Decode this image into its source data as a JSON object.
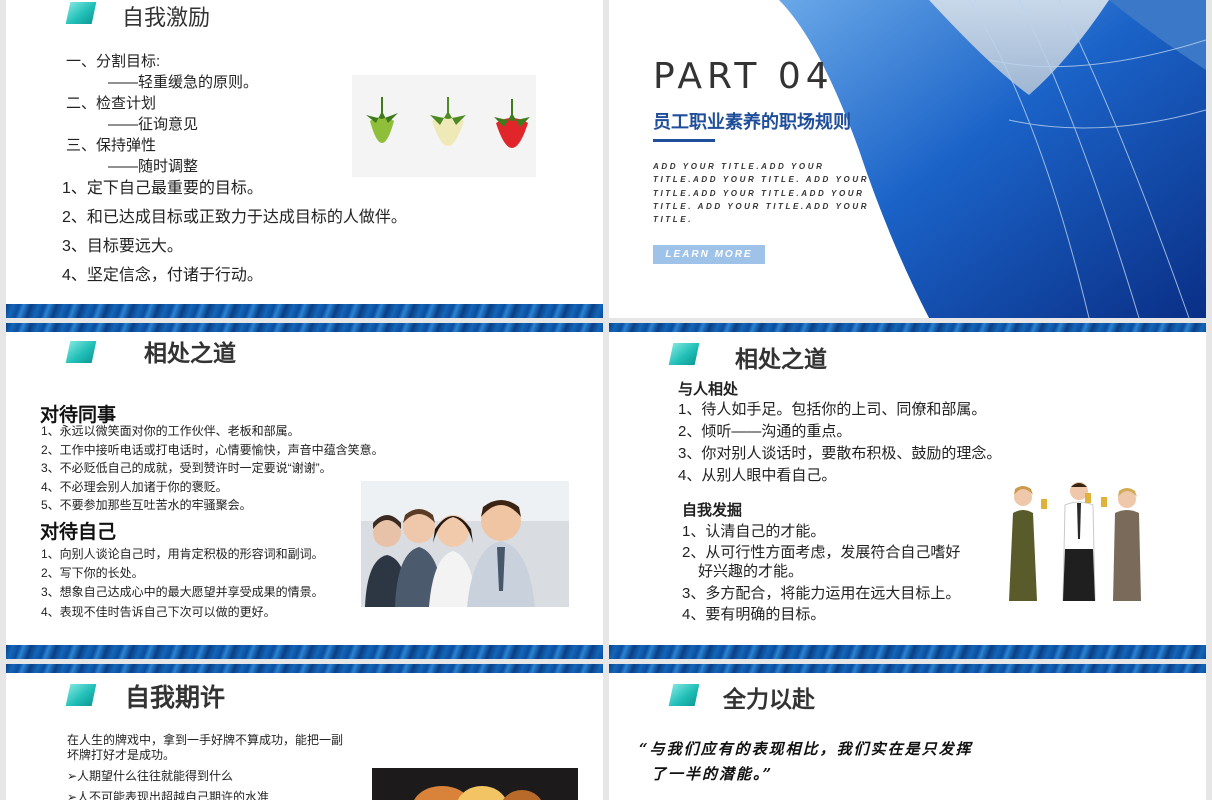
{
  "slide1": {
    "title": "自我激励",
    "lines": [
      "一、分割目标:",
      "——轻重缓急的原则。",
      "二、检查计划",
      "——征询意见",
      "三、保持弹性",
      "——随时调整"
    ],
    "points": [
      "1、定下自己最重要的目标。",
      "2、和已达成目标或正致力于达成目标的人做伴。",
      "3、目标要远大。",
      "4、坚定信念，付诸于行动。"
    ]
  },
  "slide2": {
    "part": "PART 04",
    "subtitle": "员工职业素养的职场规则",
    "tagline": "ADD YOUR TITLE.ADD YOUR TITLE.ADD YOUR TITLE. ADD YOUR TITLE.ADD YOUR TITLE.ADD YOUR TITLE. ADD YOUR TITLE.ADD YOUR TITLE.",
    "button": "LEARN MORE"
  },
  "slide3": {
    "title": "相处之道",
    "section1": "对待同事",
    "items1": [
      "1、永远以微笑面对你的工作伙伴、老板和部属。",
      "2、工作中接听电话或打电话时，心情要愉快，声音中蕴含笑意。",
      "3、不必贬低自己的成就，受到赞许时一定要说“谢谢”。",
      "4、不必理会别人加诸于你的褒贬。",
      "5、不要参加那些互吐苦水的牢骚聚会。"
    ],
    "section2": "对待自己",
    "items2": [
      "1、向别人谈论自己时，用肯定积极的形容词和副词。",
      "2、写下你的长处。",
      "3、想象自己达成心中的最大愿望并享受成果的情景。",
      "4、表现不佳时告诉自己下次可以做的更好。"
    ]
  },
  "slide4": {
    "title": "相处之道",
    "section1": "与人相处",
    "items1": [
      "1、待人如手足。包括你的上司、同僚和部属。",
      "2、倾听——沟通的重点。",
      "3、你对别人谈话时，要散布积极、鼓励的理念。",
      "4、从别人眼中看自己。"
    ],
    "section2": "自我发掘",
    "items2": [
      "1、认清自己的才能。",
      "2、从可行性方面考虑，发展符合自己嗜好",
      "好兴趣的才能。",
      "3、多方配合，将能力运用在远大目标上。",
      "4、要有明确的目标。"
    ]
  },
  "slide5": {
    "title": "自我期许",
    "intro": [
      "在人生的牌戏中，拿到一手好牌不算成功，能把一副",
      "坏牌打好才是成功。"
    ],
    "bullets": [
      "➢人期望什么往往就能得到什么",
      "➢人不可能表现出超越自己期许的水准"
    ]
  },
  "slide6": {
    "title": "全力以赴",
    "quote": [
      "“与我们应有的表现相比，我们实在是只发挥",
      "了一半的潜能。”"
    ]
  },
  "colors": {
    "accent": "#22c0b8",
    "band": "#0c4d9e",
    "subtitle": "#1f4e9a",
    "button": "#9fc2e8"
  }
}
